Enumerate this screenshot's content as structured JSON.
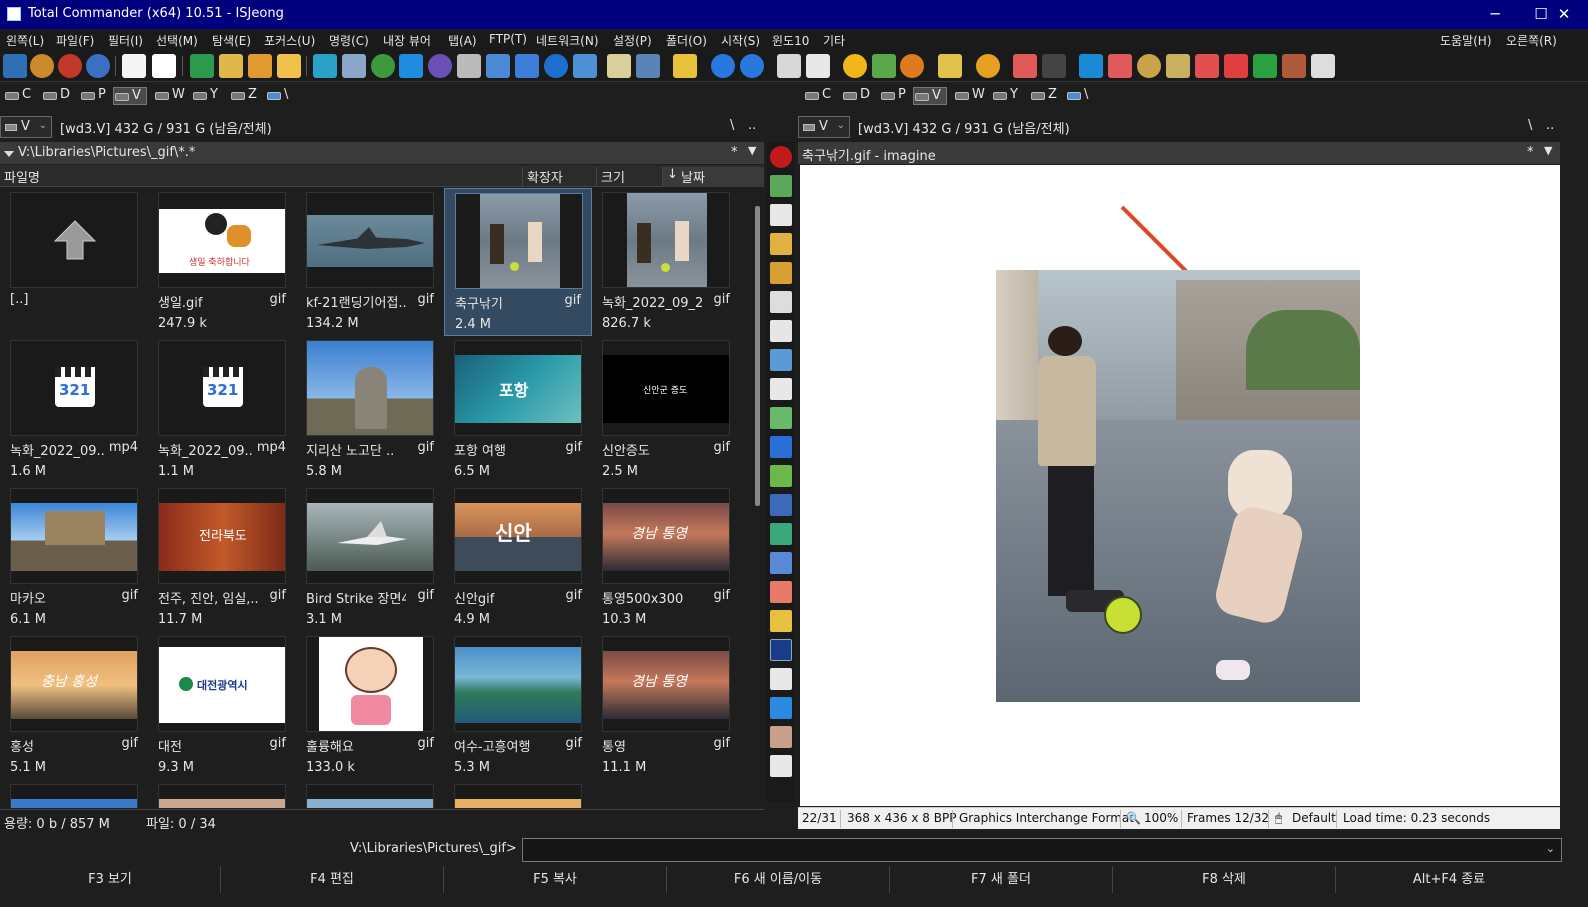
{
  "window": {
    "title": "Total Commander (x64) 10.51 - ISJeong",
    "minimize": "─",
    "maximize": "☐",
    "close": "✕"
  },
  "menu": {
    "left": [
      "왼쪽(L)",
      "파일(F)",
      "필터(I)",
      "선택(M)",
      "탐색(E)",
      "포커스(U)",
      "명령(C)",
      "내장 뷰어",
      "탭(A)",
      "FTP(T)",
      "네트워크(N)",
      "설정(P)",
      "폴더(O)",
      "시작(S)",
      "윈도10",
      "기타"
    ],
    "right": [
      "도움말(H)",
      "오른쪽(R)"
    ]
  },
  "drives": [
    "C",
    "D",
    "P",
    "V",
    "W",
    "Y",
    "Z",
    "\\"
  ],
  "left_panel": {
    "drive_combo": "V",
    "free_info": "[wd3.V]  432 G / 931 G (남음/전체)",
    "root_btn": "\\",
    "up_btn": "..",
    "path": "V:\\Libraries\\Pictures\\_gif\\*.*",
    "star": "*",
    "columns": {
      "name": "파일명",
      "ext": "확장자",
      "size": "크기",
      "date": "날짜"
    },
    "files": [
      {
        "name": "[..]",
        "ext": "",
        "size": ""
      },
      {
        "name": "생일.gif",
        "ext": "gif",
        "size": "247.9 k"
      },
      {
        "name": "kf-21랜딩기어접..",
        "ext": "gif",
        "size": "134.2 M"
      },
      {
        "name": "축구낚기",
        "ext": "gif",
        "size": "2.4 M"
      },
      {
        "name": "녹화_2022_09_2..",
        "ext": "gif",
        "size": "826.7 k"
      },
      {
        "name": "녹화_2022_09..",
        "ext": "mp4",
        "size": "1.6 M"
      },
      {
        "name": "녹화_2022_09..",
        "ext": "mp4",
        "size": "1.1 M"
      },
      {
        "name": "지리산 노고단 ..",
        "ext": "gif",
        "size": "5.8 M"
      },
      {
        "name": "포항 여행",
        "ext": "gif",
        "size": "6.5 M"
      },
      {
        "name": "신안증도",
        "ext": "gif",
        "size": "2.5 M"
      },
      {
        "name": "마카오",
        "ext": "gif",
        "size": "6.1 M"
      },
      {
        "name": "전주, 진안, 임실,..",
        "ext": "gif",
        "size": "11.7 M"
      },
      {
        "name": "Bird Strike 장면4",
        "ext": "gif",
        "size": "3.1 M"
      },
      {
        "name": "신안gif",
        "ext": "gif",
        "size": "4.9 M"
      },
      {
        "name": "통영500x300",
        "ext": "gif",
        "size": "10.3 M"
      },
      {
        "name": "홍성",
        "ext": "gif",
        "size": "5.1 M"
      },
      {
        "name": "대전",
        "ext": "gif",
        "size": "9.3 M"
      },
      {
        "name": "훌륭해요",
        "ext": "gif",
        "size": "133.0 k"
      },
      {
        "name": "여수-고흥여행",
        "ext": "gif",
        "size": "5.3 M"
      },
      {
        "name": "통영",
        "ext": "gif",
        "size": "11.1 M"
      }
    ],
    "thumb_text": {
      "birthday": "생일 축하합니다",
      "pohang": "포항",
      "sinan_jeungdo": "신안군 증도",
      "jeonbuk": "전라북도",
      "sinan": "신안",
      "tongyeong": "경남 통영",
      "hongseong": "충남 홍성",
      "daejeon": "대전광역시",
      "icon321": "321"
    },
    "status_size": "용량: 0 b / 857 M",
    "status_files": "파일: 0 / 34"
  },
  "right_panel": {
    "drive_combo": "V",
    "free_info": "[wd3.V]  432 G / 931 G (남음/전체)",
    "root_btn": "\\",
    "up_btn": "..",
    "viewer_title": "축구낚기.gif - imagine",
    "star": "*"
  },
  "lister_status": {
    "index": "22/31",
    "dims": "368 x 436 x 8 BPP",
    "format": "Graphics Interchange Format",
    "zoom": "100%",
    "frames": "Frames 12/32",
    "mode": "Default",
    "load": "Load time: 0.23 seconds"
  },
  "command_line": {
    "path": "V:\\Libraries\\Pictures\\_gif>",
    "value": ""
  },
  "function_keys": [
    "F3 보기",
    "F4 편집",
    "F5 복사",
    "F6 새 이름/이동",
    "F7 새 폴더",
    "F8 삭제",
    "Alt+F4 종료"
  ]
}
